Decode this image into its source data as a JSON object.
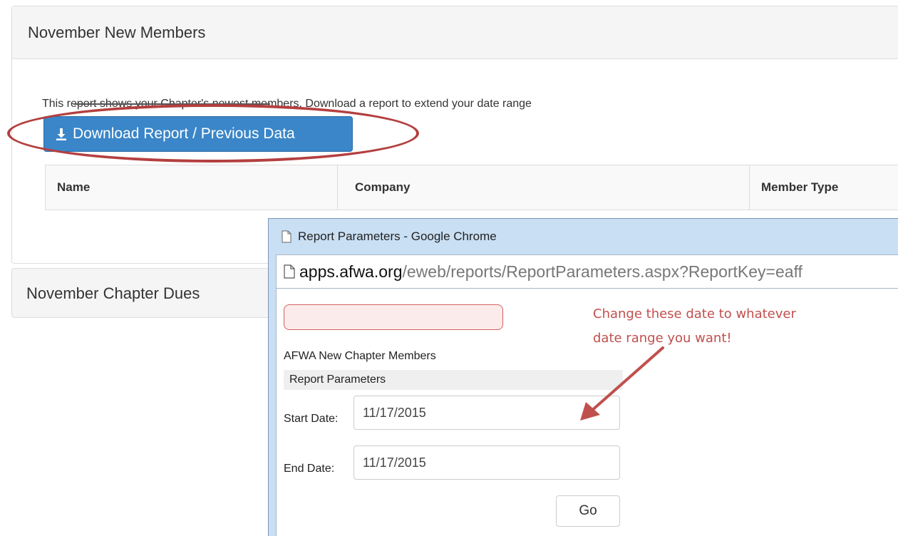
{
  "members_panel": {
    "title": "November New Members",
    "description": "This report shows your Chapter's newest members. Download a report to extend your date range",
    "download_button": "Download Report / Previous Data",
    "table_headers": [
      "Name",
      "Company",
      "Member Type"
    ]
  },
  "dues_panel": {
    "title": "November Chapter Dues"
  },
  "popup": {
    "window_title": "Report Parameters - Google Chrome",
    "url_host": "apps.afwa.org",
    "url_path": "/eweb/reports/ReportParameters.aspx?ReportKey=eaff",
    "report_title": "AFWA New Chapter Members",
    "params_header": "Report Parameters",
    "start_label": "Start Date:",
    "start_value": "11/17/2015",
    "end_label": "End Date:",
    "end_value": "11/17/2015",
    "go_button": "Go"
  },
  "annotation": {
    "line1": "Change these date to whatever",
    "line2": "date range you want!",
    "color": "#c0504d"
  },
  "colors": {
    "primary_button": "#3a86c8",
    "ellipse": "#b43f3f"
  },
  "icons": [
    "download-icon",
    "page-icon"
  ]
}
